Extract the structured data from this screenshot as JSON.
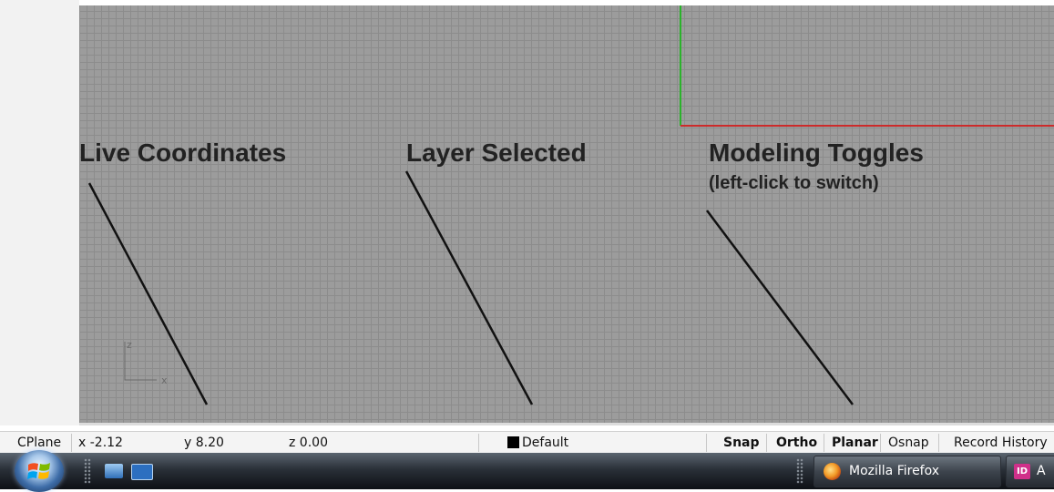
{
  "annotations": {
    "live_coordinates": "Live Coordinates",
    "layer_selected": "Layer Selected",
    "modeling_toggles": "Modeling Toggles",
    "modeling_toggles_hint": "(left-click to switch)"
  },
  "viewport": {
    "axis_z_label": "z",
    "axis_x_label": "x",
    "colors": {
      "background": "#9c9c9c",
      "grid": "#8c8c8c",
      "green_axis": "#2bb32b",
      "red_axis": "#cc2b2b"
    }
  },
  "status_bar": {
    "cplane": "CPlane",
    "x": "x -2.12",
    "y": "y 8.20",
    "z": "z 0.00",
    "layer": "Default",
    "toggles": [
      {
        "label": "Snap",
        "active": true
      },
      {
        "label": "Ortho",
        "active": true
      },
      {
        "label": "Planar",
        "active": true
      },
      {
        "label": "Osnap",
        "active": false
      },
      {
        "label": "Record History",
        "active": false
      }
    ]
  },
  "taskbar": {
    "tasks": [
      {
        "label": "Mozilla Firefox",
        "icon": "firefox-icon"
      },
      {
        "label": "A",
        "icon": "indesign-icon",
        "icon_text": "ID"
      }
    ]
  }
}
